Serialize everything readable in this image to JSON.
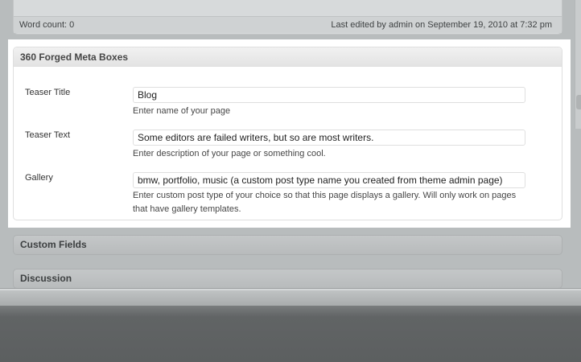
{
  "status_bar": {
    "word_count": "Word count: 0",
    "last_edited": "Last edited by admin on September 19, 2010 at 7:32 pm"
  },
  "metabox": {
    "title": "360 Forged Meta Boxes",
    "fields": [
      {
        "label": "Teaser Title",
        "value": "Blog",
        "description": "Enter name of your page"
      },
      {
        "label": "Teaser Text",
        "value": "Some editors are failed writers, but so are most writers.",
        "description": "Enter description of your page or something cool."
      },
      {
        "label": "Gallery",
        "value": "bmw, portfolio, music (a custom post type name you created from theme admin page)",
        "description_line1": "Enter custom post type of your choice so that this page displays a gallery. Will only work on pages",
        "description_line2": "that have gallery templates."
      }
    ]
  },
  "collapsed_boxes": {
    "custom_fields": "Custom Fields",
    "discussion": "Discussion"
  }
}
